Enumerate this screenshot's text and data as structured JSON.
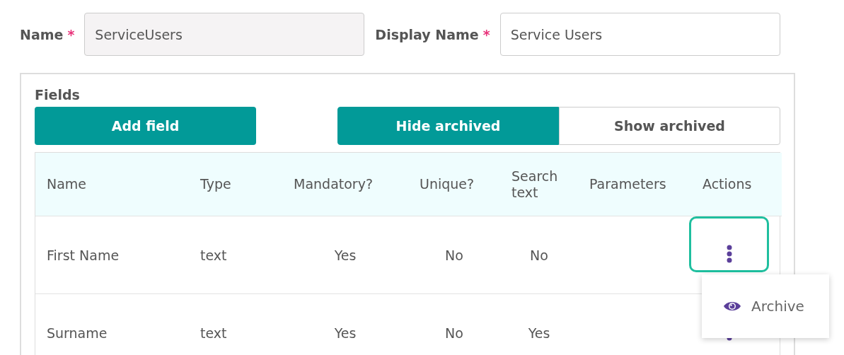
{
  "form": {
    "name": {
      "label": "Name",
      "required_mark": "*",
      "value": "ServiceUsers",
      "readonly": true
    },
    "display_name": {
      "label": "Display Name",
      "required_mark": "*",
      "value": "Service Users",
      "readonly": false
    }
  },
  "fields_panel": {
    "title": "Fields",
    "add_button": "Add field",
    "archive_toggle": [
      {
        "label": "Hide archived",
        "selected": true
      },
      {
        "label": "Show archived",
        "selected": false
      }
    ],
    "table": {
      "columns": [
        "Name",
        "Type",
        "Mandatory?",
        "Unique?",
        "Search text",
        "Parameters",
        "Actions"
      ],
      "rows": [
        {
          "name": "First Name",
          "type": "text",
          "mandatory": "Yes",
          "unique": "No",
          "search_text": "No",
          "focused": true
        },
        {
          "name": "Surname",
          "type": "text",
          "mandatory": "Yes",
          "unique": "No",
          "search_text": "Yes",
          "focused": false
        }
      ]
    }
  },
  "actions_menu": {
    "items": [
      {
        "label": "Archive"
      }
    ]
  }
}
